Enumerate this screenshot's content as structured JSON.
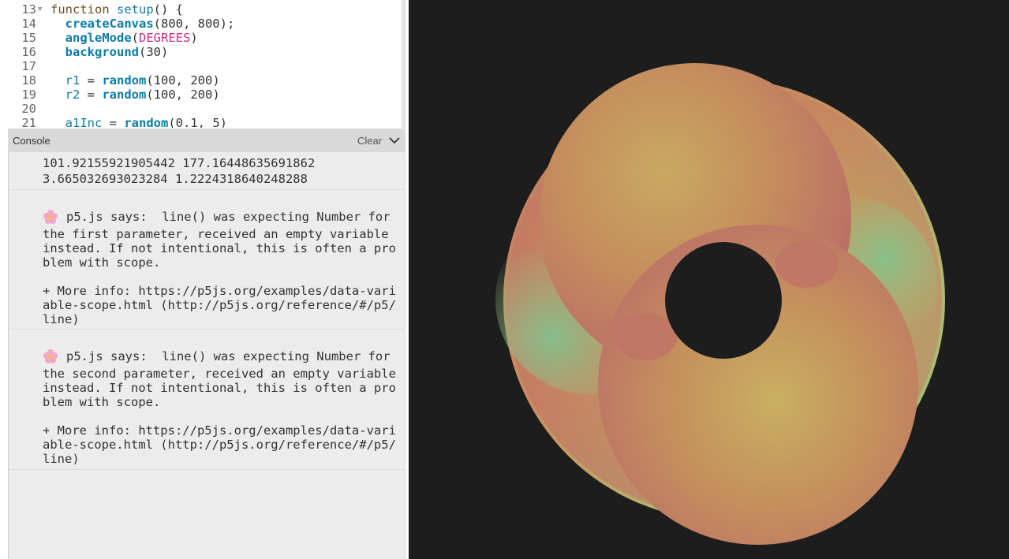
{
  "editor": {
    "lines": [
      {
        "num": "13",
        "fold": true,
        "tokens": [
          {
            "t": "function",
            "c": "kw"
          },
          {
            "t": " ",
            "c": ""
          },
          {
            "t": "setup",
            "c": "fn"
          },
          {
            "t": "() {",
            "c": ""
          }
        ]
      },
      {
        "num": "14",
        "fold": false,
        "tokens": [
          {
            "t": "  ",
            "c": ""
          },
          {
            "t": "createCanvas",
            "c": "bi"
          },
          {
            "t": "(800, 800);",
            "c": ""
          }
        ]
      },
      {
        "num": "15",
        "fold": false,
        "tokens": [
          {
            "t": "  ",
            "c": ""
          },
          {
            "t": "angleMode",
            "c": "bi"
          },
          {
            "t": "(",
            "c": ""
          },
          {
            "t": "DEGREES",
            "c": "const"
          },
          {
            "t": ")",
            "c": ""
          }
        ]
      },
      {
        "num": "16",
        "fold": false,
        "tokens": [
          {
            "t": "  ",
            "c": ""
          },
          {
            "t": "background",
            "c": "bi"
          },
          {
            "t": "(30)",
            "c": ""
          }
        ]
      },
      {
        "num": "17",
        "fold": false,
        "tokens": []
      },
      {
        "num": "18",
        "fold": false,
        "tokens": [
          {
            "t": "  ",
            "c": ""
          },
          {
            "t": "r1",
            "c": "var"
          },
          {
            "t": " = ",
            "c": ""
          },
          {
            "t": "random",
            "c": "bi"
          },
          {
            "t": "(100, 200)",
            "c": ""
          }
        ]
      },
      {
        "num": "19",
        "fold": false,
        "tokens": [
          {
            "t": "  ",
            "c": ""
          },
          {
            "t": "r2",
            "c": "var"
          },
          {
            "t": " = ",
            "c": ""
          },
          {
            "t": "random",
            "c": "bi"
          },
          {
            "t": "(100, 200)",
            "c": ""
          }
        ]
      },
      {
        "num": "20",
        "fold": false,
        "tokens": []
      },
      {
        "num": "21",
        "fold": false,
        "tokens": [
          {
            "t": "  ",
            "c": ""
          },
          {
            "t": "a1Inc",
            "c": "var"
          },
          {
            "t": " = ",
            "c": ""
          },
          {
            "t": "random",
            "c": "bi"
          },
          {
            "t": "(0.1, 5)",
            "c": ""
          }
        ]
      }
    ]
  },
  "console": {
    "title": "Console",
    "clear_label": "Clear",
    "log": {
      "line1": "101.92155921905442 177.16448635691862",
      "line2": "3.665032693023284 1.2224318640248288"
    },
    "messages": [
      {
        "lines": [
          "p5.js says:  line() was expecting Number for",
          "the first parameter, received an empty variable",
          "instead. If not intentional, this is often a pro",
          "blem with scope.",
          "",
          "+ More info: https://p5js.org/examples/data-vari",
          "able-scope.html (http://p5js.org/reference/#/p5/",
          "line)"
        ]
      },
      {
        "lines": [
          "p5.js says:  line() was expecting Number for",
          "the second parameter, received an empty variable",
          "instead. If not intentional, this is often a pro",
          "blem with scope.",
          "",
          "+ More info: https://p5js.org/examples/data-vari",
          "able-scope.html (http://p5js.org/reference/#/p5/",
          "line)"
        ]
      }
    ]
  },
  "canvas": {
    "background": "#1d1d1d",
    "ring_colors": {
      "red": "#c06c66",
      "orange": "#c8925c",
      "yellow": "#c4ac62",
      "green": "#7fc391",
      "lightgreen": "#a0c878"
    }
  }
}
